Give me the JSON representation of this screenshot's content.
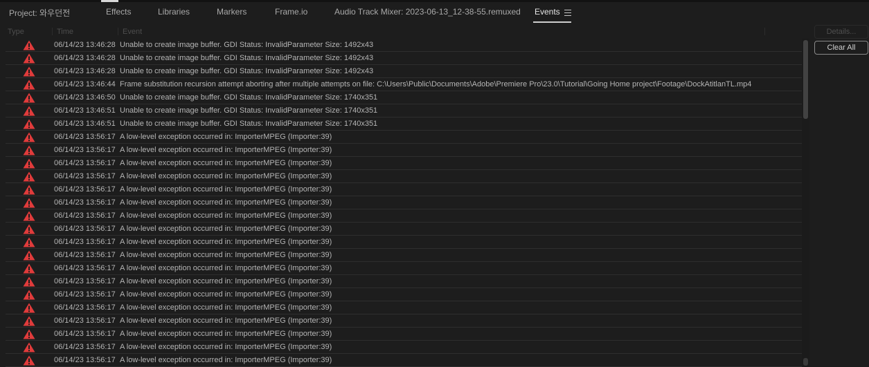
{
  "tabs": [
    {
      "label": "Project: 와우던전",
      "active": false
    },
    {
      "label": "Effects",
      "active": false
    },
    {
      "label": "Libraries",
      "active": false
    },
    {
      "label": "Markers",
      "active": false
    },
    {
      "label": "Frame.io",
      "active": false
    },
    {
      "label": "Audio Track Mixer: 2023-06-13_12-38-55.remuxed",
      "active": false
    },
    {
      "label": "Events",
      "active": true
    }
  ],
  "columns": {
    "type": "Type",
    "time": "Time",
    "event": "Event"
  },
  "buttons": {
    "details": "Details...",
    "clear_all": "Clear All"
  },
  "colors": {
    "warning_icon": "#e03b3b",
    "background": "#1d1d1d"
  },
  "events": [
    {
      "icon": "warning-icon",
      "time": "06/14/23 13:46:28",
      "event": "Unable to create image buffer. GDI Status: InvalidParameter Size: 1492x43"
    },
    {
      "icon": "warning-icon",
      "time": "06/14/23 13:46:28",
      "event": "Unable to create image buffer. GDI Status: InvalidParameter Size: 1492x43"
    },
    {
      "icon": "warning-icon",
      "time": "06/14/23 13:46:28",
      "event": "Unable to create image buffer. GDI Status: InvalidParameter Size: 1492x43"
    },
    {
      "icon": "warning-icon",
      "time": "06/14/23 13:46:44",
      "event": "Frame substitution recursion attempt aborting after multiple attempts on file: C:\\Users\\Public\\Documents\\Adobe\\Premiere Pro\\23.0\\Tutorial\\Going Home project\\Footage\\DockAtitlanTL.mp4"
    },
    {
      "icon": "warning-icon",
      "time": "06/14/23 13:46:50",
      "event": "Unable to create image buffer. GDI Status: InvalidParameter Size: 1740x351"
    },
    {
      "icon": "warning-icon",
      "time": "06/14/23 13:46:51",
      "event": "Unable to create image buffer. GDI Status: InvalidParameter Size: 1740x351"
    },
    {
      "icon": "warning-icon",
      "time": "06/14/23 13:46:51",
      "event": "Unable to create image buffer. GDI Status: InvalidParameter Size: 1740x351"
    },
    {
      "icon": "warning-icon",
      "time": "06/14/23 13:56:17",
      "event": "A low-level exception occurred in: ImporterMPEG (Importer:39)"
    },
    {
      "icon": "warning-icon",
      "time": "06/14/23 13:56:17",
      "event": "A low-level exception occurred in: ImporterMPEG (Importer:39)"
    },
    {
      "icon": "warning-icon",
      "time": "06/14/23 13:56:17",
      "event": "A low-level exception occurred in: ImporterMPEG (Importer:39)"
    },
    {
      "icon": "warning-icon",
      "time": "06/14/23 13:56:17",
      "event": "A low-level exception occurred in: ImporterMPEG (Importer:39)"
    },
    {
      "icon": "warning-icon",
      "time": "06/14/23 13:56:17",
      "event": "A low-level exception occurred in: ImporterMPEG (Importer:39)"
    },
    {
      "icon": "warning-icon",
      "time": "06/14/23 13:56:17",
      "event": "A low-level exception occurred in: ImporterMPEG (Importer:39)"
    },
    {
      "icon": "warning-icon",
      "time": "06/14/23 13:56:17",
      "event": "A low-level exception occurred in: ImporterMPEG (Importer:39)"
    },
    {
      "icon": "warning-icon",
      "time": "06/14/23 13:56:17",
      "event": "A low-level exception occurred in: ImporterMPEG (Importer:39)"
    },
    {
      "icon": "warning-icon",
      "time": "06/14/23 13:56:17",
      "event": "A low-level exception occurred in: ImporterMPEG (Importer:39)"
    },
    {
      "icon": "warning-icon",
      "time": "06/14/23 13:56:17",
      "event": "A low-level exception occurred in: ImporterMPEG (Importer:39)"
    },
    {
      "icon": "warning-icon",
      "time": "06/14/23 13:56:17",
      "event": "A low-level exception occurred in: ImporterMPEG (Importer:39)"
    },
    {
      "icon": "warning-icon",
      "time": "06/14/23 13:56:17",
      "event": "A low-level exception occurred in: ImporterMPEG (Importer:39)"
    },
    {
      "icon": "warning-icon",
      "time": "06/14/23 13:56:17",
      "event": "A low-level exception occurred in: ImporterMPEG (Importer:39)"
    },
    {
      "icon": "warning-icon",
      "time": "06/14/23 13:56:17",
      "event": "A low-level exception occurred in: ImporterMPEG (Importer:39)"
    },
    {
      "icon": "warning-icon",
      "time": "06/14/23 13:56:17",
      "event": "A low-level exception occurred in: ImporterMPEG (Importer:39)"
    },
    {
      "icon": "warning-icon",
      "time": "06/14/23 13:56:17",
      "event": "A low-level exception occurred in: ImporterMPEG (Importer:39)"
    },
    {
      "icon": "warning-icon",
      "time": "06/14/23 13:56:17",
      "event": "A low-level exception occurred in: ImporterMPEG (Importer:39)"
    },
    {
      "icon": "warning-icon",
      "time": "06/14/23 13:56:17",
      "event": "A low-level exception occurred in: ImporterMPEG (Importer:39)"
    }
  ]
}
